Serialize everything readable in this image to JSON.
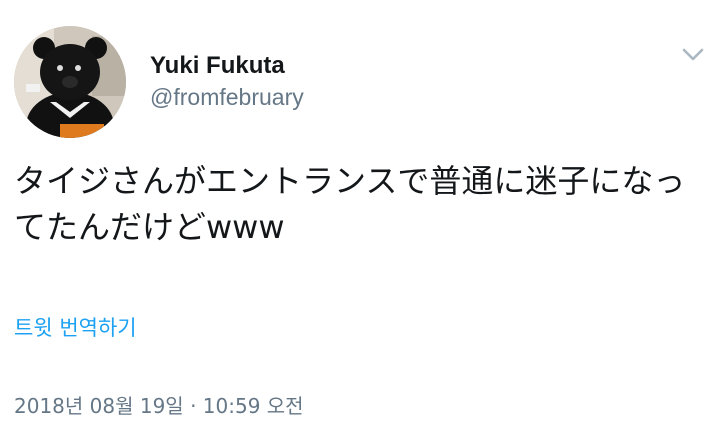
{
  "tweet": {
    "author": {
      "display_name": "Yuki Fukuta",
      "handle": "@fromfebruary",
      "avatar": "bear-mascot-avatar"
    },
    "menu_icon": "chevron-down-icon",
    "text": "タイジさんがエントランスで普通に迷子になってたんだけどwww",
    "translate_label": "트윗 번역하기",
    "timestamp": "2018년 08월 19일 · 10:59 오전"
  },
  "colors": {
    "text_primary": "#14171a",
    "text_secondary": "#657786",
    "link": "#1da1f2",
    "chevron": "#aab8c2"
  }
}
